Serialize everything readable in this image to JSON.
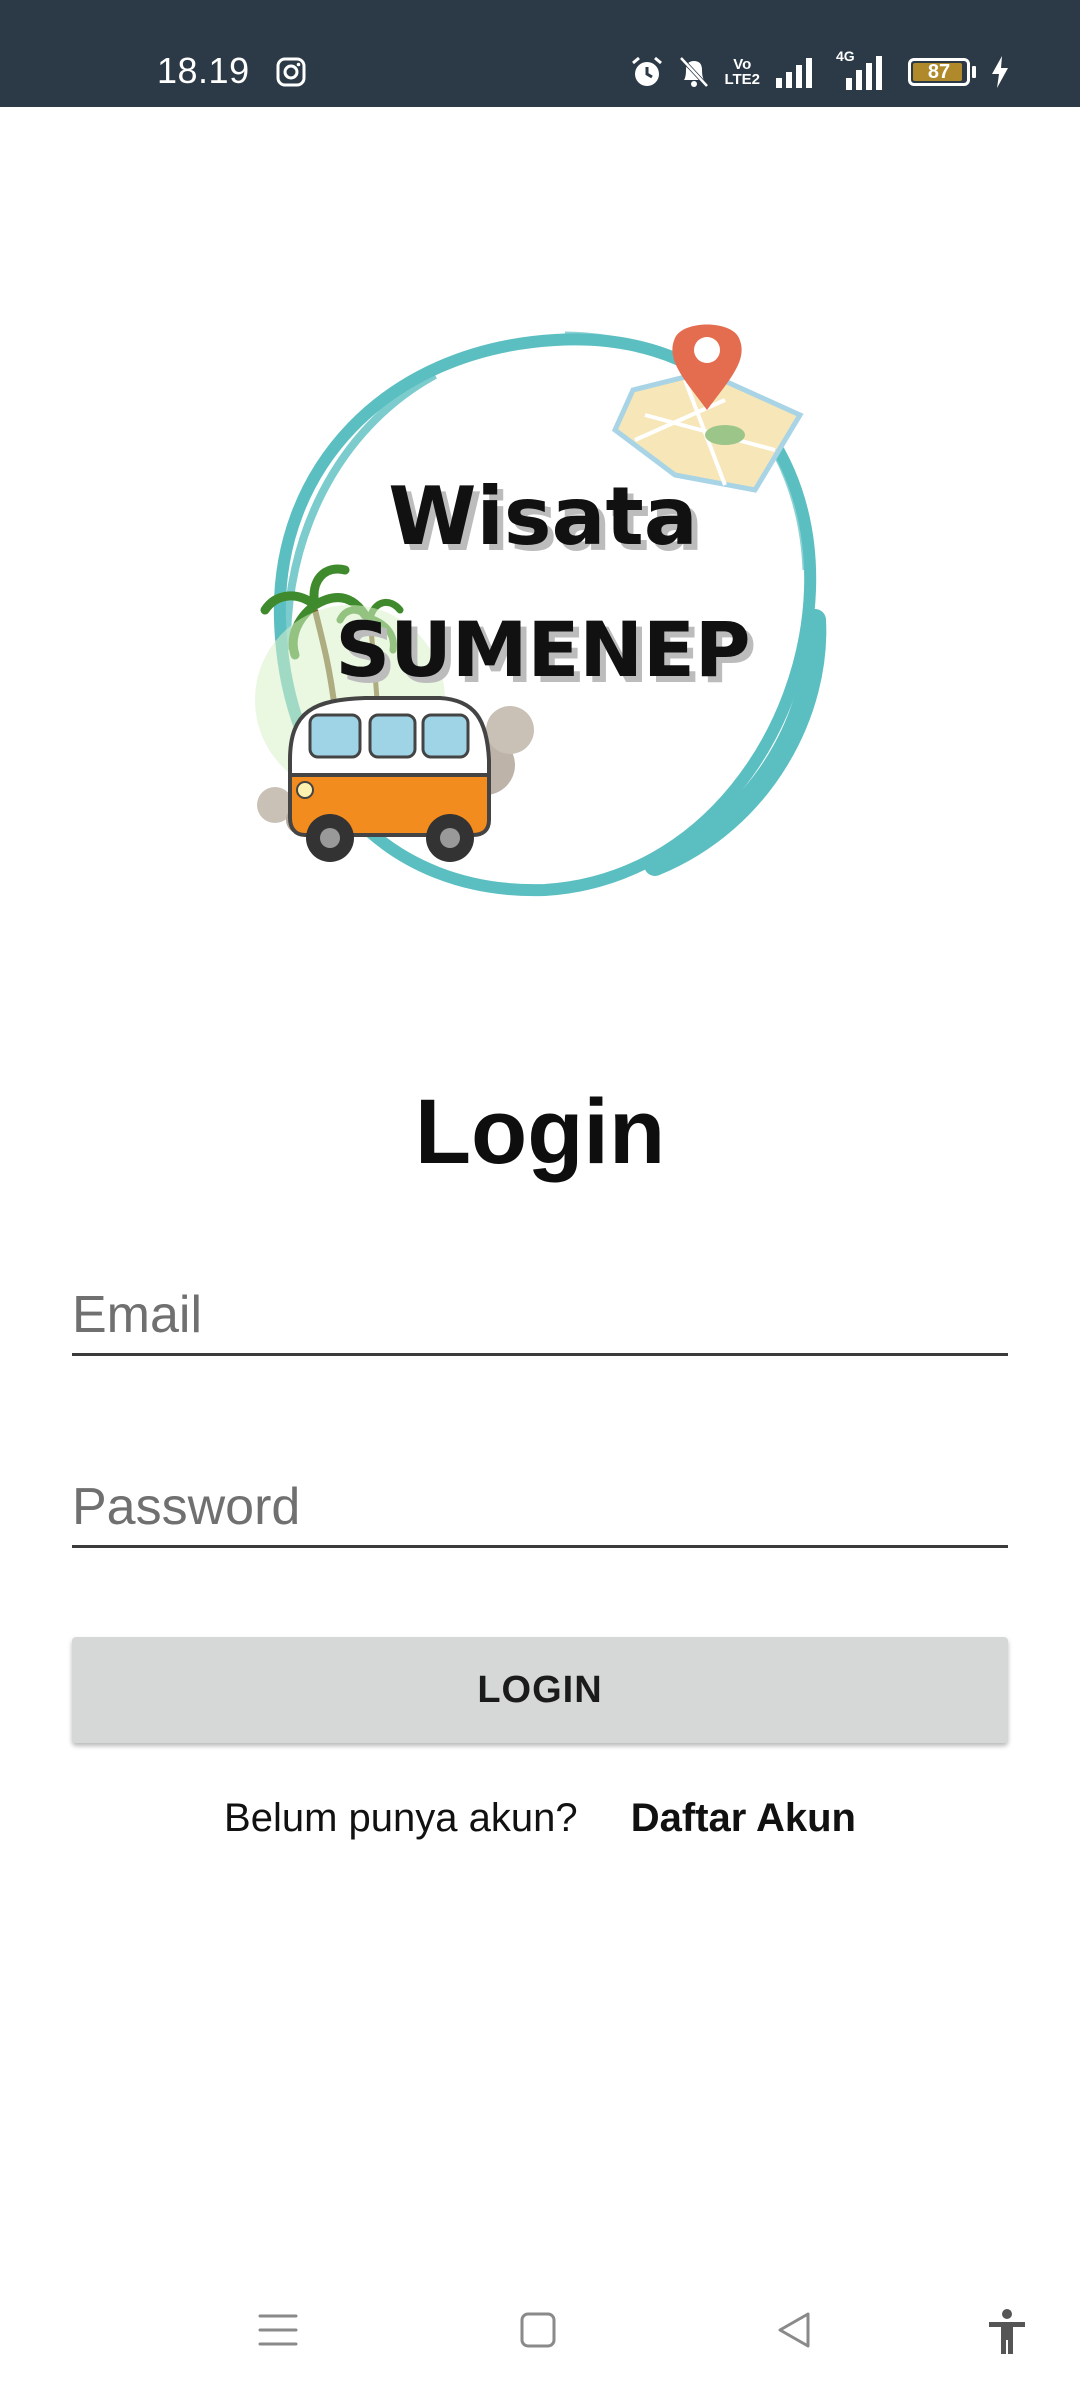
{
  "status_bar": {
    "time": "18.19",
    "battery_level": "87",
    "network_label": "4G",
    "volte_top": "Vo",
    "volte_bottom": "LTE2",
    "icons": [
      "instagram-icon",
      "alarm-icon",
      "bell-off-icon",
      "volte-icon",
      "signal-icon",
      "signal-4g-icon",
      "battery-icon",
      "charging-icon"
    ]
  },
  "logo": {
    "line1": "Wisata",
    "line2": "SUMENEP",
    "accent_color": "#5bbfc2",
    "pin_color": "#e46d50",
    "van_color": "#f28c1f"
  },
  "page": {
    "title": "Login"
  },
  "form": {
    "email_placeholder": "Email",
    "email_value": "",
    "password_placeholder": "Password",
    "password_value": "",
    "login_label": "LOGIN"
  },
  "register": {
    "prompt": "Belum punya akun?",
    "link_label": "Daftar Akun"
  },
  "nav_bar": {
    "icons": [
      "menu-icon",
      "home-icon",
      "back-icon",
      "accessibility-icon"
    ]
  }
}
